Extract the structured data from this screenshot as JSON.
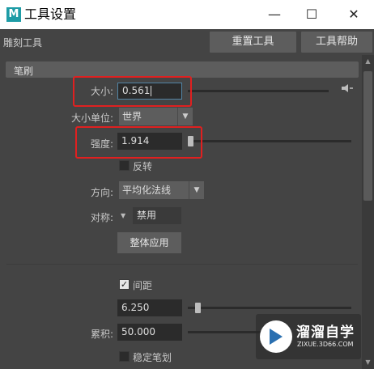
{
  "window": {
    "icon_letter": "M",
    "title": "工具设置",
    "minimize_glyph": "—",
    "maximize_glyph": "☐",
    "close_glyph": "✕"
  },
  "toolbar": {
    "tool_name": "雕刻工具",
    "reset_label": "重置工具",
    "help_label": "工具帮助"
  },
  "section": {
    "title": "笔刷"
  },
  "brush": {
    "size_label": "大小:",
    "size_value": "0.561",
    "unit_label": "大小单位:",
    "unit_value": "世界",
    "strength_label": "强度:",
    "strength_value": "1.914",
    "invert_label": "反转",
    "invert_checked": false,
    "direction_label": "方向:",
    "direction_value": "平均化法线",
    "symmetry_label": "对称:",
    "symmetry_value": "禁用",
    "apply_all_label": "整体应用",
    "spacing_label": "间距",
    "spacing_checked": true,
    "spacing_value": "6.250",
    "buildup_label": "累积:",
    "buildup_value": "50.000",
    "stabilize_label": "稳定笔划",
    "stabilize_checked": false
  },
  "watermark": {
    "title": "溜溜自学",
    "subtitle": "ZIXUE.3D66.COM"
  },
  "colors": {
    "panel_bg": "#444444",
    "field_bg": "#2b2b2b",
    "button_bg": "#5d5d5d",
    "highlight_red": "#e02020",
    "focus_blue": "#5285a6"
  }
}
